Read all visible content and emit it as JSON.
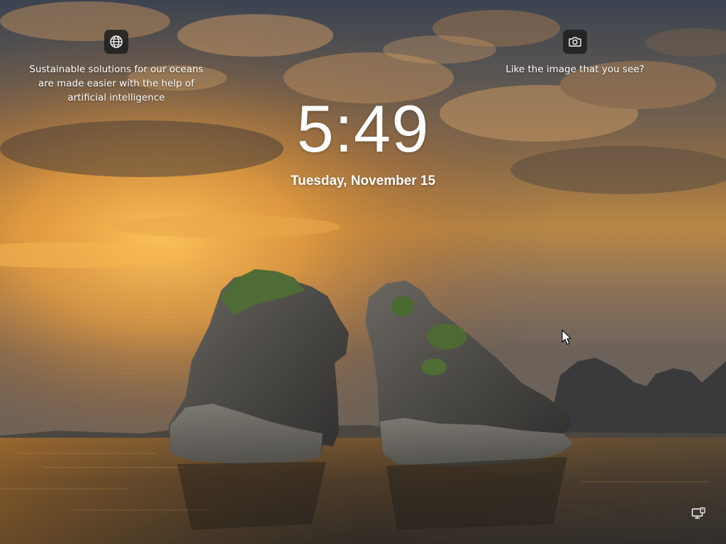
{
  "lockscreen": {
    "clock": "5:49",
    "date": "Tuesday, November 15",
    "spotlight_fact": {
      "icon": "globe-icon",
      "text": "Sustainable solutions for our oceans are made easier with the help of artificial intelligence"
    },
    "spotlight_feedback": {
      "icon": "camera-icon",
      "text": "Like the image that you see?"
    },
    "status_icons": [
      "network-icon"
    ]
  },
  "colors": {
    "text": "#ffffff",
    "icon_background": "#202020",
    "sky_glow": "#f4a23a",
    "water": "#5a4a34"
  }
}
